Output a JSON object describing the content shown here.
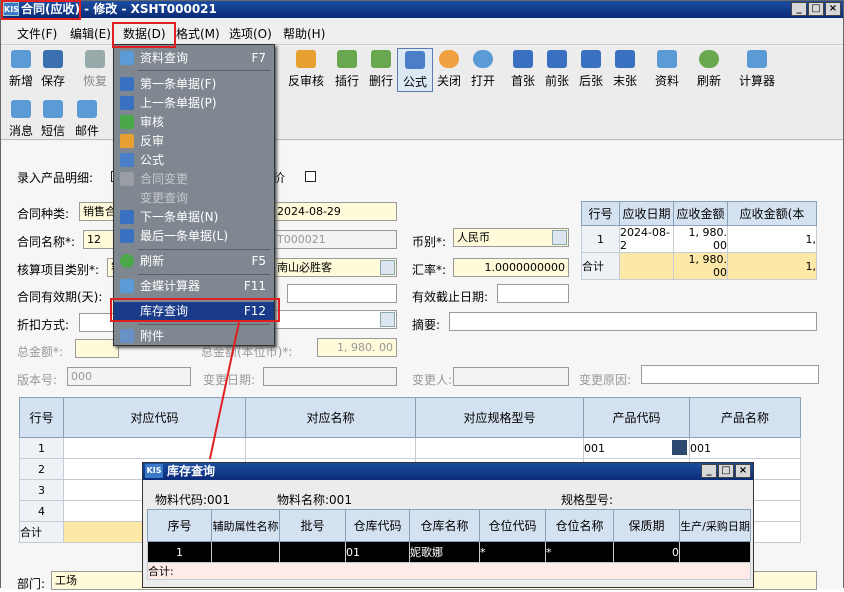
{
  "window": {
    "title": "合同(应收) - 修改 - XSHT000021",
    "app_icon": "KIS"
  },
  "menubar": [
    "文件(F)",
    "编辑(E)",
    "数据(D)",
    "格式(M)",
    "选项(O)",
    "帮助(H)"
  ],
  "toolbar": [
    "新增",
    "保存",
    "恢复",
    "反审核",
    "插行",
    "删行",
    "公式",
    "关闭",
    "打开",
    "首张",
    "前张",
    "后张",
    "末张",
    "资料",
    "刷新",
    "计算器"
  ],
  "toolbar2": [
    "消息",
    "短信",
    "邮件"
  ],
  "menu": [
    {
      "label": "资料查询",
      "shortcut": "F7",
      "disabled": false
    },
    {
      "label": "第一条单据(F)",
      "shortcut": "",
      "disabled": false
    },
    {
      "label": "上一条单据(P)",
      "shortcut": "",
      "disabled": false
    },
    {
      "label": "审核",
      "shortcut": "",
      "disabled": false
    },
    {
      "label": "反审",
      "shortcut": "",
      "disabled": false
    },
    {
      "label": "公式",
      "shortcut": "",
      "disabled": false
    },
    {
      "label": "合同变更",
      "shortcut": "",
      "disabled": true
    },
    {
      "label": "变更查询",
      "shortcut": "",
      "disabled": true
    },
    {
      "label": "下一条单据(N)",
      "shortcut": "",
      "disabled": false
    },
    {
      "label": "最后一条单据(L)",
      "shortcut": "",
      "disabled": false
    },
    {
      "label": "刷新",
      "shortcut": "F5",
      "disabled": false
    },
    {
      "label": "金蝶计算器",
      "shortcut": "F11",
      "disabled": false
    },
    {
      "label": "库存查询",
      "shortcut": "F12",
      "disabled": false
    },
    {
      "label": "附件",
      "shortcut": "",
      "disabled": false
    }
  ],
  "form": {
    "entry_label": "录入产品明细:",
    "price_label": "价",
    "contract_type_label": "合同种类:",
    "contract_type": "销售合",
    "date_value": "2024-08-29",
    "contract_name_label": "合同名称*:",
    "contract_name": "12",
    "code_value": "T000021",
    "currency_label": "币别*:",
    "currency": "人民币",
    "item_type_label": "核算项目类别*:",
    "item_type": "客",
    "customer": "南山必胜客",
    "rate_label": "汇率*:",
    "rate": "1.0000000000",
    "valid_days_label": "合同有效期(天):",
    "end_date_label": "有效截止日期:",
    "discount_label": "折扣方式:",
    "summary_label": "摘要:",
    "total_label": "总金额*:",
    "total_base_label": "总金额(本位币)*:",
    "total_base": "1, 980. 00",
    "version_label": "版本号:",
    "version": "000",
    "change_date_label": "变更日期:",
    "changer_label": "变更人:",
    "change_reason_label": "变更原因:",
    "dept_label": "部门:",
    "dept": "工场"
  },
  "ar_grid": {
    "headers": [
      "行号",
      "应收日期",
      "应收金额",
      "应收金额(本"
    ],
    "rows": [
      [
        "1",
        "2024-08-2",
        "1, 980. 00",
        "1,"
      ]
    ],
    "total_label": "合计",
    "total": "1, 980. 00",
    "total_tail": "1,"
  },
  "detail_grid": {
    "headers": [
      "行号",
      "对应代码",
      "对应名称",
      "对应规格型号",
      "产品代码",
      "产品名称"
    ],
    "row_numbers": [
      "1",
      "2",
      "3",
      "4"
    ],
    "row1_code": "001",
    "row1_code2": "001",
    "total_label": "合计"
  },
  "inventory": {
    "title": "库存查询",
    "material_code_label": "物料代码:001",
    "material_name_label": "物料名称:001",
    "spec_label": "规格型号:",
    "headers": [
      "序号",
      "辅助属性名称",
      "批号",
      "仓库代码",
      "仓库名称",
      "仓位代码",
      "仓位名称",
      "保质期",
      "生产/采购日期"
    ],
    "row": [
      "1",
      "",
      "",
      "01",
      "妮歌娜",
      "*",
      "*",
      "0",
      ""
    ],
    "total_label": "合计:"
  }
}
